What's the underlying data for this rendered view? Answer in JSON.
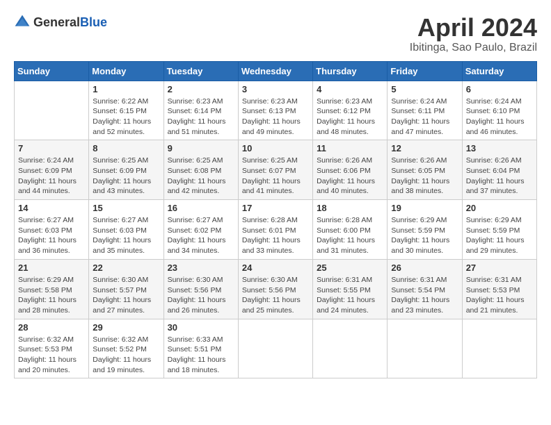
{
  "header": {
    "logo_general": "General",
    "logo_blue": "Blue",
    "month_title": "April 2024",
    "location": "Ibitinga, Sao Paulo, Brazil"
  },
  "weekdays": [
    "Sunday",
    "Monday",
    "Tuesday",
    "Wednesday",
    "Thursday",
    "Friday",
    "Saturday"
  ],
  "weeks": [
    [
      {
        "day": "",
        "sunrise": "",
        "sunset": "",
        "daylight": ""
      },
      {
        "day": "1",
        "sunrise": "Sunrise: 6:22 AM",
        "sunset": "Sunset: 6:15 PM",
        "daylight": "Daylight: 11 hours and 52 minutes."
      },
      {
        "day": "2",
        "sunrise": "Sunrise: 6:23 AM",
        "sunset": "Sunset: 6:14 PM",
        "daylight": "Daylight: 11 hours and 51 minutes."
      },
      {
        "day": "3",
        "sunrise": "Sunrise: 6:23 AM",
        "sunset": "Sunset: 6:13 PM",
        "daylight": "Daylight: 11 hours and 49 minutes."
      },
      {
        "day": "4",
        "sunrise": "Sunrise: 6:23 AM",
        "sunset": "Sunset: 6:12 PM",
        "daylight": "Daylight: 11 hours and 48 minutes."
      },
      {
        "day": "5",
        "sunrise": "Sunrise: 6:24 AM",
        "sunset": "Sunset: 6:11 PM",
        "daylight": "Daylight: 11 hours and 47 minutes."
      },
      {
        "day": "6",
        "sunrise": "Sunrise: 6:24 AM",
        "sunset": "Sunset: 6:10 PM",
        "daylight": "Daylight: 11 hours and 46 minutes."
      }
    ],
    [
      {
        "day": "7",
        "sunrise": "Sunrise: 6:24 AM",
        "sunset": "Sunset: 6:09 PM",
        "daylight": "Daylight: 11 hours and 44 minutes."
      },
      {
        "day": "8",
        "sunrise": "Sunrise: 6:25 AM",
        "sunset": "Sunset: 6:09 PM",
        "daylight": "Daylight: 11 hours and 43 minutes."
      },
      {
        "day": "9",
        "sunrise": "Sunrise: 6:25 AM",
        "sunset": "Sunset: 6:08 PM",
        "daylight": "Daylight: 11 hours and 42 minutes."
      },
      {
        "day": "10",
        "sunrise": "Sunrise: 6:25 AM",
        "sunset": "Sunset: 6:07 PM",
        "daylight": "Daylight: 11 hours and 41 minutes."
      },
      {
        "day": "11",
        "sunrise": "Sunrise: 6:26 AM",
        "sunset": "Sunset: 6:06 PM",
        "daylight": "Daylight: 11 hours and 40 minutes."
      },
      {
        "day": "12",
        "sunrise": "Sunrise: 6:26 AM",
        "sunset": "Sunset: 6:05 PM",
        "daylight": "Daylight: 11 hours and 38 minutes."
      },
      {
        "day": "13",
        "sunrise": "Sunrise: 6:26 AM",
        "sunset": "Sunset: 6:04 PM",
        "daylight": "Daylight: 11 hours and 37 minutes."
      }
    ],
    [
      {
        "day": "14",
        "sunrise": "Sunrise: 6:27 AM",
        "sunset": "Sunset: 6:03 PM",
        "daylight": "Daylight: 11 hours and 36 minutes."
      },
      {
        "day": "15",
        "sunrise": "Sunrise: 6:27 AM",
        "sunset": "Sunset: 6:03 PM",
        "daylight": "Daylight: 11 hours and 35 minutes."
      },
      {
        "day": "16",
        "sunrise": "Sunrise: 6:27 AM",
        "sunset": "Sunset: 6:02 PM",
        "daylight": "Daylight: 11 hours and 34 minutes."
      },
      {
        "day": "17",
        "sunrise": "Sunrise: 6:28 AM",
        "sunset": "Sunset: 6:01 PM",
        "daylight": "Daylight: 11 hours and 33 minutes."
      },
      {
        "day": "18",
        "sunrise": "Sunrise: 6:28 AM",
        "sunset": "Sunset: 6:00 PM",
        "daylight": "Daylight: 11 hours and 31 minutes."
      },
      {
        "day": "19",
        "sunrise": "Sunrise: 6:29 AM",
        "sunset": "Sunset: 5:59 PM",
        "daylight": "Daylight: 11 hours and 30 minutes."
      },
      {
        "day": "20",
        "sunrise": "Sunrise: 6:29 AM",
        "sunset": "Sunset: 5:59 PM",
        "daylight": "Daylight: 11 hours and 29 minutes."
      }
    ],
    [
      {
        "day": "21",
        "sunrise": "Sunrise: 6:29 AM",
        "sunset": "Sunset: 5:58 PM",
        "daylight": "Daylight: 11 hours and 28 minutes."
      },
      {
        "day": "22",
        "sunrise": "Sunrise: 6:30 AM",
        "sunset": "Sunset: 5:57 PM",
        "daylight": "Daylight: 11 hours and 27 minutes."
      },
      {
        "day": "23",
        "sunrise": "Sunrise: 6:30 AM",
        "sunset": "Sunset: 5:56 PM",
        "daylight": "Daylight: 11 hours and 26 minutes."
      },
      {
        "day": "24",
        "sunrise": "Sunrise: 6:30 AM",
        "sunset": "Sunset: 5:56 PM",
        "daylight": "Daylight: 11 hours and 25 minutes."
      },
      {
        "day": "25",
        "sunrise": "Sunrise: 6:31 AM",
        "sunset": "Sunset: 5:55 PM",
        "daylight": "Daylight: 11 hours and 24 minutes."
      },
      {
        "day": "26",
        "sunrise": "Sunrise: 6:31 AM",
        "sunset": "Sunset: 5:54 PM",
        "daylight": "Daylight: 11 hours and 23 minutes."
      },
      {
        "day": "27",
        "sunrise": "Sunrise: 6:31 AM",
        "sunset": "Sunset: 5:53 PM",
        "daylight": "Daylight: 11 hours and 21 minutes."
      }
    ],
    [
      {
        "day": "28",
        "sunrise": "Sunrise: 6:32 AM",
        "sunset": "Sunset: 5:53 PM",
        "daylight": "Daylight: 11 hours and 20 minutes."
      },
      {
        "day": "29",
        "sunrise": "Sunrise: 6:32 AM",
        "sunset": "Sunset: 5:52 PM",
        "daylight": "Daylight: 11 hours and 19 minutes."
      },
      {
        "day": "30",
        "sunrise": "Sunrise: 6:33 AM",
        "sunset": "Sunset: 5:51 PM",
        "daylight": "Daylight: 11 hours and 18 minutes."
      },
      {
        "day": "",
        "sunrise": "",
        "sunset": "",
        "daylight": ""
      },
      {
        "day": "",
        "sunrise": "",
        "sunset": "",
        "daylight": ""
      },
      {
        "day": "",
        "sunrise": "",
        "sunset": "",
        "daylight": ""
      },
      {
        "day": "",
        "sunrise": "",
        "sunset": "",
        "daylight": ""
      }
    ]
  ]
}
